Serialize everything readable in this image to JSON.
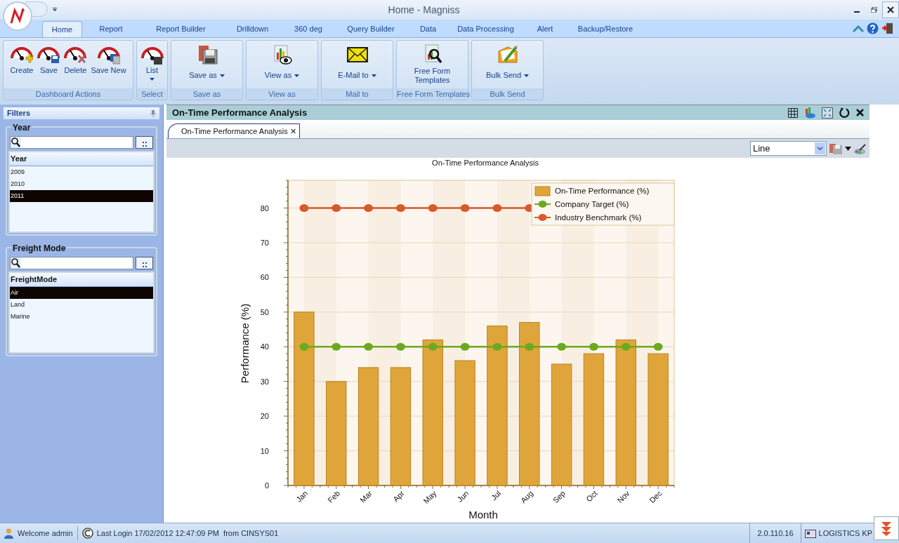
{
  "window": {
    "title": "Home - Magniss"
  },
  "ribbon_tabs": [
    {
      "label": "Home",
      "selected": true
    },
    {
      "label": "Report",
      "selected": false
    },
    {
      "label": "Report Builder",
      "selected": false
    },
    {
      "label": "Drilldown",
      "selected": false
    },
    {
      "label": "360 deg",
      "selected": false
    },
    {
      "label": "Query Builder",
      "selected": false
    },
    {
      "label": "Data",
      "selected": false
    },
    {
      "label": "Data Processing",
      "selected": false
    },
    {
      "label": "Alert",
      "selected": false
    },
    {
      "label": "Backup/Restore",
      "selected": false
    }
  ],
  "ribbon_groups": [
    {
      "label": "Dashboard Actions",
      "buttons": [
        {
          "label": "Create",
          "kind": "create",
          "dropdown": false
        },
        {
          "label": "Save",
          "kind": "save",
          "dropdown": false
        },
        {
          "label": "Delete",
          "kind": "delete",
          "dropdown": false
        },
        {
          "label": "Save New",
          "kind": "savenew",
          "dropdown": false
        }
      ]
    },
    {
      "label": "Select",
      "buttons": [
        {
          "label": "List",
          "kind": "list",
          "dropdown": true
        }
      ]
    },
    {
      "label": "Save as",
      "buttons": [
        {
          "label": "Save as",
          "kind": "floppy",
          "dropdown": true
        }
      ]
    },
    {
      "label": "View as",
      "buttons": [
        {
          "label": "View as",
          "kind": "view",
          "dropdown": true
        }
      ]
    },
    {
      "label": "Mail to",
      "buttons": [
        {
          "label": "E-Mail to",
          "kind": "mail",
          "dropdown": true
        }
      ]
    },
    {
      "label": "Free Form Templates",
      "buttons": [
        {
          "label": "Free Form Templates",
          "kind": "template",
          "dropdown": false
        }
      ]
    },
    {
      "label": "Bulk Send",
      "buttons": [
        {
          "label": "Bulk Send",
          "kind": "bulk",
          "dropdown": true
        }
      ]
    }
  ],
  "filters": {
    "title": "Filters",
    "panels": [
      {
        "title": "Year",
        "column": "Year",
        "items": [
          {
            "label": "2009",
            "selected": false
          },
          {
            "label": "2010",
            "selected": false
          },
          {
            "label": "2011",
            "selected": true
          }
        ]
      },
      {
        "title": "Freight Mode",
        "column": "FreightMode",
        "items": [
          {
            "label": "Air",
            "selected": true
          },
          {
            "label": "Land",
            "selected": false
          },
          {
            "label": "Marine",
            "selected": false
          }
        ]
      }
    ]
  },
  "panel": {
    "title": "On-Time Performance Analysis",
    "tabs": [
      {
        "label": "On-Time Performance Analysis",
        "selected": true,
        "close": "✕"
      }
    ],
    "chart_type": "Line",
    "chart_data": {
      "type": "bar",
      "title": "On-Time Performance Analysis",
      "xlabel": "Month",
      "ylabel": "Performance (%)",
      "categories": [
        "Jan",
        "Feb",
        "Mar",
        "Apr",
        "May",
        "Jun",
        "Jul",
        "Aug",
        "Sep",
        "Oct",
        "Nov",
        "Dec"
      ],
      "series": [
        {
          "name": "On-Time Performance (%)",
          "type": "bar",
          "color": "#e0a53a",
          "values": [
            50,
            30,
            34,
            34,
            42,
            36,
            46,
            47,
            35,
            38,
            42,
            38
          ]
        },
        {
          "name": "Company Target (%)",
          "type": "line",
          "marker": "o",
          "color": "#6aaa1e",
          "values": [
            40,
            40,
            40,
            40,
            40,
            40,
            40,
            40,
            40,
            40,
            40,
            40
          ]
        },
        {
          "name": "Industry Benchmark (%)",
          "type": "line",
          "marker": "o",
          "color": "#d9582c",
          "values": [
            80,
            80,
            80,
            80,
            80,
            80,
            80,
            80,
            null,
            null,
            null,
            null
          ]
        }
      ],
      "grid": {
        "y": true
      },
      "legend": true,
      "ylim": [
        0,
        88
      ],
      "yticks": [
        0,
        10,
        20,
        30,
        40,
        50,
        60,
        70,
        80
      ]
    }
  },
  "status_bar": {
    "welcome": "Welcome admin",
    "last_login": "Last Login 17/02/2012 12:47:09 PM  from CINSYS01",
    "version": "2.0.110.16",
    "company": "LOGISTICS KP"
  }
}
